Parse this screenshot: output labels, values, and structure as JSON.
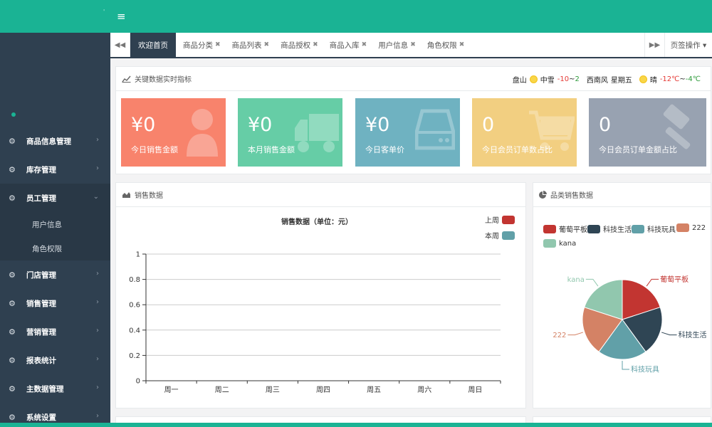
{
  "topbar": {
    "menu_icon": "hamburger-icon",
    "menu_glyph": "≡",
    "mark": "'"
  },
  "sidebar": {
    "menu": [
      {
        "label": "商品信息管理",
        "arrow": "›",
        "open": false
      },
      {
        "label": "库存管理",
        "arrow": "›",
        "open": false
      },
      {
        "label": "员工管理",
        "arrow": "⌄",
        "open": true,
        "children": [
          "用户信息",
          "角色权限"
        ]
      },
      {
        "label": "门店管理",
        "arrow": "›",
        "open": false
      },
      {
        "label": "销售管理",
        "arrow": "›",
        "open": false
      },
      {
        "label": "营销管理",
        "arrow": "›",
        "open": false
      },
      {
        "label": "报表统计",
        "arrow": "›",
        "open": false
      },
      {
        "label": "主数据管理",
        "arrow": "›",
        "open": false
      },
      {
        "label": "系统设置",
        "arrow": "›",
        "open": false
      }
    ],
    "icon": "gears-icon"
  },
  "tabbar": {
    "tabs": [
      {
        "label": "欢迎首页",
        "active": true,
        "closable": false
      },
      {
        "label": "商品分类",
        "active": false,
        "closable": true
      },
      {
        "label": "商品列表",
        "active": false,
        "closable": true
      },
      {
        "label": "商品授权",
        "active": false,
        "closable": true
      },
      {
        "label": "商品入库",
        "active": false,
        "closable": true
      },
      {
        "label": "用户信息",
        "active": false,
        "closable": true
      },
      {
        "label": "角色权限",
        "active": false,
        "closable": true
      }
    ],
    "close_glyph": "✖",
    "prev_glyph": "◀◀",
    "next_glyph": "▶▶",
    "dropdown_label": "页签操作 ▾"
  },
  "kpi_panel": {
    "title": "关键数据实时指标",
    "weather": {
      "city": "盘山",
      "today_cond": "中雪",
      "today_low": "-10",
      "today_sep": "~",
      "today_high": "2",
      "wind": "西南风",
      "weekday": "星期五",
      "tomorrow_cond": "晴",
      "tomorrow_high": "-12℃",
      "tomorrow_sep": "~",
      "tomorrow_low": "-4℃"
    },
    "cards": [
      {
        "value": "¥0",
        "label": "今日销售金额",
        "color": "#f8836c",
        "icon": "user-icon"
      },
      {
        "value": "¥0",
        "label": "本月销售金额",
        "color": "#66cda6",
        "icon": "truck-icon"
      },
      {
        "value": "¥0",
        "label": "今日客单价",
        "color": "#6fb2c1",
        "icon": "hard-drive-icon"
      },
      {
        "value": "0",
        "label": "今日会员订单数占比",
        "color": "#f2cf81",
        "icon": "cart-icon"
      },
      {
        "value": "0",
        "label": "今日会员订单金额占比",
        "color": "#98a2b1",
        "icon": "gavel-icon"
      }
    ]
  },
  "sales_panel": {
    "title": "销售数据"
  },
  "category_panel": {
    "title": "品类销售数据"
  },
  "chart_data": [
    {
      "type": "line",
      "title": "销售数据（单位：元）",
      "categories": [
        "周一",
        "周二",
        "周三",
        "周四",
        "周五",
        "周六",
        "周日"
      ],
      "series": [
        {
          "name": "上周",
          "values": [],
          "color": "#c23531"
        },
        {
          "name": "本周",
          "values": [],
          "color": "#61a0a8"
        }
      ],
      "yticks": [
        "0",
        "0.2",
        "0.4",
        "0.6",
        "0.8",
        "1"
      ],
      "ylim": [
        0,
        1
      ],
      "grid": true,
      "legend": "top-right"
    },
    {
      "type": "pie",
      "title": "",
      "slices": [
        {
          "name": "葡萄平板",
          "value": 1,
          "color": "#c23531"
        },
        {
          "name": "科技生活",
          "value": 1,
          "color": "#2f4554"
        },
        {
          "name": "科技玩具",
          "value": 1,
          "color": "#61a0a8"
        },
        {
          "name": "222",
          "value": 1,
          "color": "#d48265"
        },
        {
          "name": "kana",
          "value": 1,
          "color": "#91c7ae"
        }
      ],
      "legend": "top-left"
    }
  ]
}
